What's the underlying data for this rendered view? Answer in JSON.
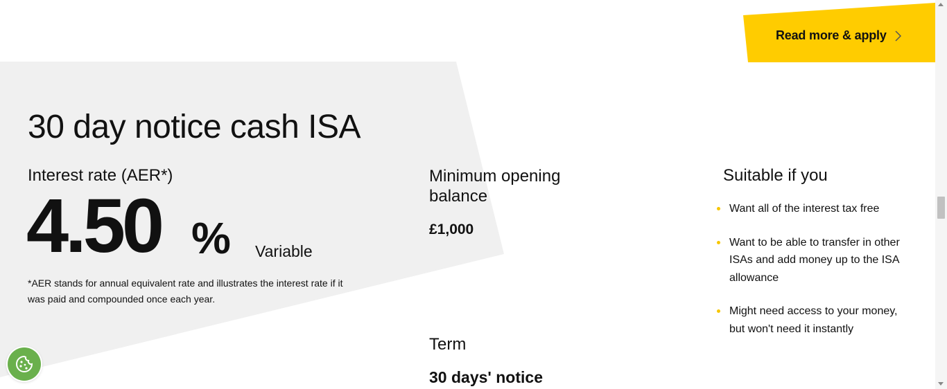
{
  "cta": {
    "label": "Read more & apply",
    "icon": "chevron-right-icon",
    "color": "#ffcc00"
  },
  "product": {
    "title": "30 day notice cash ISA",
    "rate": {
      "label": "Interest rate (AER*)",
      "value": "4.50",
      "unit": "%",
      "type": "Variable"
    },
    "aer_note": "*AER stands for annual equivalent rate and illustrates the interest rate if it was paid and compounded once each year.",
    "minimum_balance": {
      "label": "Minimum opening balance",
      "value": "£1,000"
    },
    "term": {
      "label": "Term",
      "value": "30 days' notice"
    },
    "suitable": {
      "label": "Suitable if you",
      "items": [
        "Want all of the interest tax free",
        "Want to be able to transfer in other ISAs and add money up to the ISA allowance",
        "Might need access to your money, but won't need it instantly"
      ]
    }
  },
  "cookie_button": {
    "icon": "cookie-icon",
    "color": "#6ab04c"
  },
  "colors": {
    "accent": "#ffcc00",
    "panel": "#f0f0f0",
    "text": "#111111"
  }
}
